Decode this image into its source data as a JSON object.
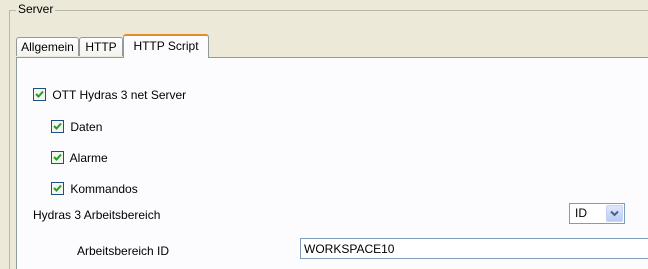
{
  "group": {
    "title": "Server"
  },
  "tabs": [
    {
      "label": "Allgemein",
      "active": false
    },
    {
      "label": "HTTP",
      "active": false
    },
    {
      "label": "HTTP Script",
      "active": true
    }
  ],
  "settings": {
    "server": {
      "label": "OTT Hydras 3 net Server",
      "checked": true
    },
    "daten": {
      "label": "Daten",
      "checked": true
    },
    "alarme": {
      "label": "Alarme",
      "checked": true
    },
    "kommandos": {
      "label": "Kommandos",
      "checked": true
    },
    "workspace_label": "Hydras 3  Arbeitsbereich",
    "workspace_mode": "ID",
    "workspace_id_label": "Arbeitsbereich ID",
    "workspace_id_value": "WORKSPACE10"
  },
  "icons": {
    "checkmark": "checkmark-icon",
    "dropdown": "chevron-down-icon"
  },
  "colors": {
    "window_bg": "#ECE9D8",
    "panel_bg": "#FCFCFE",
    "checkmark": "#21A121",
    "active_tab_accent": "#E68B2C",
    "input_border": "#7F9DB9"
  }
}
